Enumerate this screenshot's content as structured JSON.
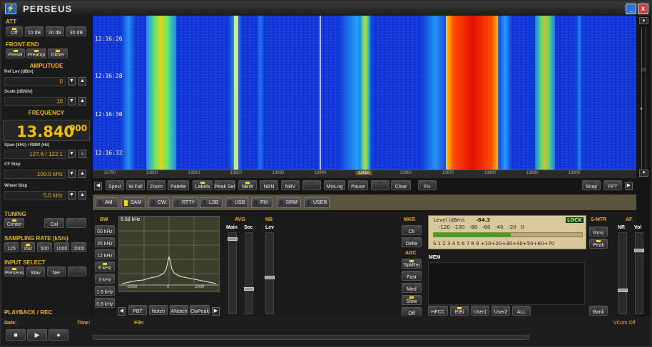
{
  "app": {
    "title": "PERSEUS",
    "icon": "app-logo-icon"
  },
  "window": {
    "minimize": "_",
    "close": "x"
  },
  "att": {
    "title": "ATT",
    "buttons": [
      "Off",
      "10 dB",
      "20 dB",
      "30 dB"
    ]
  },
  "frontend": {
    "title": "FRONT-END",
    "buttons": [
      "Presel",
      "Preamp",
      "Dither"
    ]
  },
  "amplitude": {
    "title": "AMPLITUDE",
    "ref_label": "Ref Lev (dBm)",
    "ref_value": "0",
    "scale_label": "Scale (dB/div)",
    "scale_value": "10"
  },
  "frequency": {
    "title": "FREQUENCY",
    "main": "13.840",
    "fine": "000",
    "span_label": "Span (kHz) / RBW (Hz)",
    "span_value": "127.6 / 122.1",
    "cf_label": "CF Step",
    "cf_value": "100.0 kHz",
    "wheel_label": "Wheel Step",
    "wheel_value": "5.0 kHz"
  },
  "tuning": {
    "title": "TUNING",
    "buttons": [
      "Center",
      "Cal",
      ""
    ]
  },
  "sampling": {
    "title": "SAMPLING RATE (kS/s)",
    "buttons": [
      "125",
      "250",
      "500",
      "1000",
      "2000"
    ]
  },
  "input": {
    "title": "INPUT SELECT",
    "buttons": [
      "Perseus",
      "Wav",
      "Ner",
      ""
    ]
  },
  "playback": {
    "title": "PLAYBACK / REC",
    "date_label": "Date:",
    "time_label": "Time:",
    "file_label": "File:",
    "status": "VCom Off"
  },
  "waterfall": {
    "timestamps": [
      "12:16:26",
      "12:16:28",
      "12:16:30",
      "12:16:32"
    ]
  },
  "freq_scale": {
    "ticks": [
      "13790",
      "13800",
      "13810",
      "13820",
      "13830",
      "13840",
      "13850",
      "13860",
      "13870",
      "13880",
      "13890",
      "13900"
    ]
  },
  "toolbar": {
    "buttons": [
      "Spect",
      "W.Fall",
      "Zoom",
      "Palette",
      "Labels",
      "Peak Sel",
      "NBW",
      "NBN",
      "NBV",
      "",
      "MinLog",
      "Pause",
      "",
      "Clear",
      "Fn",
      "Snap",
      "FFT"
    ]
  },
  "modes": [
    "AM",
    "SAM",
    "CW",
    "RTTY",
    "LSB",
    "USB",
    "FM",
    "DRM",
    "USER"
  ],
  "bw": {
    "title": "BW",
    "buttons": [
      "50 kHz",
      "25 kHz",
      "12 kHz",
      "6 kHz",
      "3 kHz",
      "1.6 kHz",
      "0.8 kHz"
    ],
    "readout": "5.68 kHz",
    "axis": [
      "-2000",
      "0",
      "2000"
    ]
  },
  "filters": {
    "buttons": [
      "PBT",
      "Notch",
      "ANotch",
      "CwPeak"
    ]
  },
  "avg": {
    "title": "AVG",
    "main": "Main",
    "sec": "Sec"
  },
  "nb": {
    "title": "NB",
    "lev": "Lev"
  },
  "mkr": {
    "title": "MKR",
    "buttons": [
      "Clr",
      "Delta"
    ]
  },
  "agc": {
    "title": "AGC",
    "buttons": [
      "SpkRej",
      "Fast",
      "Med",
      "Slow",
      "Off"
    ]
  },
  "meter": {
    "level_label": "Level (dBm):",
    "level_value": "-84.3",
    "lock": "LOCK",
    "dbm_scale": "-120  -100   -80   -60   -40   -20   0",
    "s_scale": "S 1 2 3 4 5 6 7 8 9 +10+20+30+40+50+60+70",
    "bar_fraction": 0.52
  },
  "smtr": {
    "title": "S-MTR",
    "buttons": [
      "Rms",
      "Peak"
    ]
  },
  "af": {
    "title": "AF",
    "nr": "NR",
    "vol": "Vol"
  },
  "mem": {
    "title": "MEM",
    "buttons": [
      "HFCC",
      "EiBi",
      "User1",
      "User2",
      "ALL",
      "Bank"
    ]
  },
  "colors": {
    "accent": "#f0b400",
    "spectrum_bg": "#1236d0",
    "led_on": "#ffd800"
  }
}
